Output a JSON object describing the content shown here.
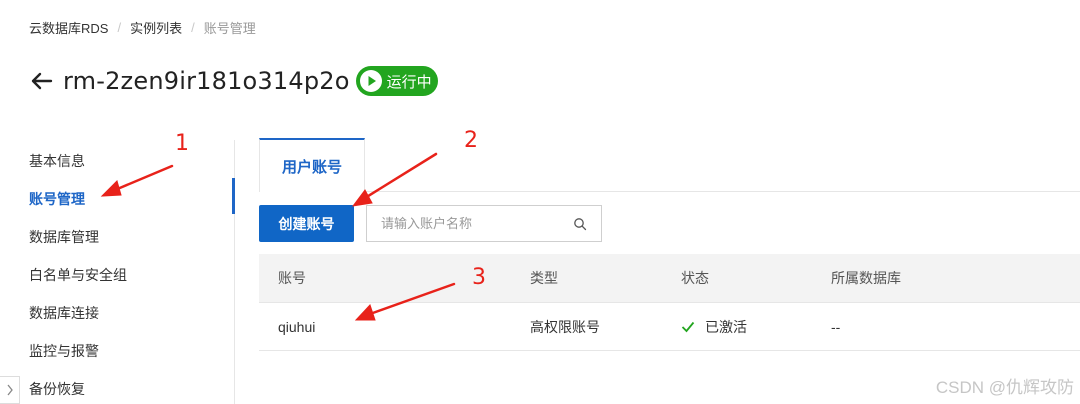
{
  "breadcrumb": [
    "云数据库RDS",
    "实例列表",
    "账号管理"
  ],
  "instance": {
    "name": "rm-2zen9ir181o314p2o",
    "status": "运行中"
  },
  "sidebar": {
    "items": [
      {
        "label": "基本信息"
      },
      {
        "label": "账号管理",
        "active": true
      },
      {
        "label": "数据库管理"
      },
      {
        "label": "白名单与安全组"
      },
      {
        "label": "数据库连接"
      },
      {
        "label": "监控与报警"
      },
      {
        "label": "备份恢复"
      }
    ]
  },
  "tabs": [
    {
      "label": "用户账号",
      "active": true
    }
  ],
  "toolbar": {
    "create_label": "创建账号",
    "search_placeholder": "请输入账户名称"
  },
  "table": {
    "headers": [
      "账号",
      "类型",
      "状态",
      "所属数据库"
    ],
    "rows": [
      {
        "account": "qiuhui",
        "type": "高权限账号",
        "status": "已激活",
        "database": "--"
      }
    ]
  },
  "annotations": [
    "1",
    "2",
    "3"
  ],
  "watermark": "CSDN @仇辉攻防",
  "colors": {
    "accent": "#1e66c7",
    "running": "#22a51f",
    "annotation": "#e8221a"
  }
}
